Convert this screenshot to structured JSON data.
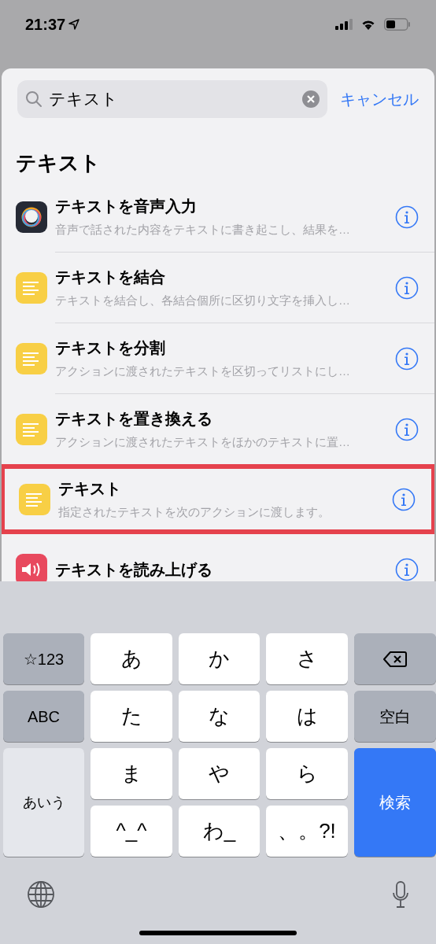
{
  "status_bar": {
    "time": "21:37"
  },
  "search": {
    "value": "テキスト",
    "cancel": "キャンセル"
  },
  "section_title": "テキスト",
  "actions": [
    {
      "kind": "dictation",
      "title": "テキストを音声入力",
      "subtitle": "音声で話された内容をテキストに書き起こし、結果を…",
      "highlighted": false
    },
    {
      "kind": "text",
      "title": "テキストを結合",
      "subtitle": "テキストを結合し、各結合個所に区切り文字を挿入し…",
      "highlighted": false
    },
    {
      "kind": "text",
      "title": "テキストを分割",
      "subtitle": "アクションに渡されたテキストを区切ってリストにし…",
      "highlighted": false
    },
    {
      "kind": "text",
      "title": "テキストを置き換える",
      "subtitle": "アクションに渡されたテキストをほかのテキストに置…",
      "highlighted": false
    },
    {
      "kind": "text",
      "title": "テキスト",
      "subtitle": "指定されたテキストを次のアクションに渡します。",
      "highlighted": true
    },
    {
      "kind": "speak",
      "title": "テキストを読み上げる",
      "highlighted": false
    }
  ],
  "keyboard": {
    "keys": [
      {
        "kind": "function",
        "label": "☆123"
      },
      {
        "kind": "char",
        "label": "あ"
      },
      {
        "kind": "char",
        "label": "か"
      },
      {
        "kind": "char",
        "label": "さ"
      },
      {
        "kind": "delete"
      },
      {
        "kind": "function",
        "label": "ABC"
      },
      {
        "kind": "char",
        "label": "た"
      },
      {
        "kind": "char",
        "label": "な"
      },
      {
        "kind": "char",
        "label": "は"
      },
      {
        "kind": "function",
        "label": "空白"
      },
      {
        "kind": "mode",
        "label": "あいう"
      },
      {
        "kind": "char",
        "label": "ま"
      },
      {
        "kind": "char",
        "label": "や"
      },
      {
        "kind": "char",
        "label": "ら"
      },
      {
        "kind": "primary",
        "label": "検索"
      },
      {
        "kind": "char",
        "label": "^_^"
      },
      {
        "kind": "char",
        "label": "わ_"
      },
      {
        "kind": "char",
        "label": "、。?!"
      }
    ]
  }
}
